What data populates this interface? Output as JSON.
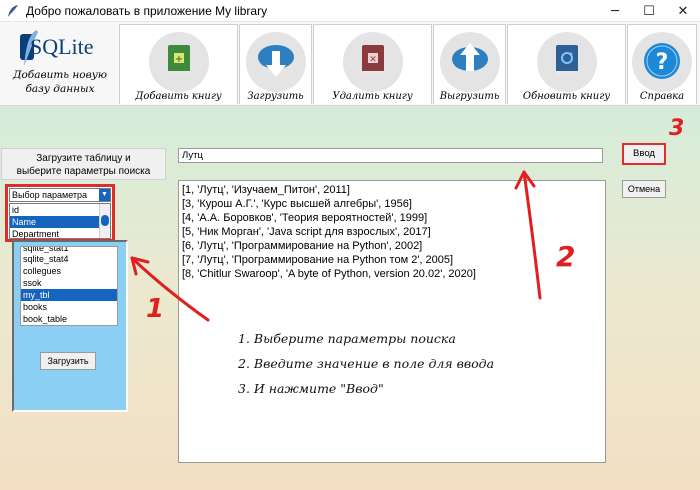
{
  "window": {
    "title": "Добро пожаловать в приложение My library",
    "minimize": "─",
    "maximize": "☐",
    "close": "✕"
  },
  "logo": {
    "brand": "SQLite",
    "line1": "Добавить новую",
    "line2": "базу данных"
  },
  "toolbar": {
    "buttons": [
      {
        "label": "Добавить книгу",
        "icon": "add-book-icon"
      },
      {
        "label": "Загрузить",
        "icon": "cloud-download-icon"
      },
      {
        "label": "Удалить книгу",
        "icon": "delete-book-icon"
      },
      {
        "label": "Выгрузить",
        "icon": "cloud-upload-icon"
      },
      {
        "label": "Обновить книгу",
        "icon": "refresh-book-icon"
      },
      {
        "label": "Справка",
        "icon": "help-icon"
      }
    ]
  },
  "left": {
    "hint_line1": "Загрузите таблицу и",
    "hint_line2": "выберите параметры поиска",
    "param_select": "Выбор параметра",
    "param_options": [
      "id",
      "Name",
      "Department"
    ],
    "tables_partial": "sqlite_stat1",
    "tables": [
      "sqlite_stat4",
      "collegues",
      "ssok",
      "my_tbl",
      "books",
      "book_table"
    ],
    "load_label": "Загрузить"
  },
  "search": {
    "value": "Лутц"
  },
  "buttons": {
    "enter": "Ввод",
    "cancel": "Отмена"
  },
  "results": [
    "[1, 'Лутц', 'Изучаем_Питон', 2011]",
    "[3, 'Курош А.Г.', 'Курс высшей алгебры', 1956]",
    "[4, 'А.А. Боровков', 'Теория вероятностей', 1999]",
    "[5, 'Ник Морган', 'Java script для взрослых', 2017]",
    "[6, 'Лутц', 'Программирование на Python', 2002]",
    "[7, 'Лутц', 'Программирование на Python том 2', 2005]",
    "[8, 'Chitlur Swaroop', 'A byte of Python, version 20.02', 2020]"
  ],
  "annotations": {
    "step1": "1. Выберите параметры поиска",
    "step2": "2. Введите значение в поле для ввода",
    "step3": "3. И нажмите \"Ввод\"",
    "num1": "1",
    "num2": "2",
    "num3": "3"
  }
}
